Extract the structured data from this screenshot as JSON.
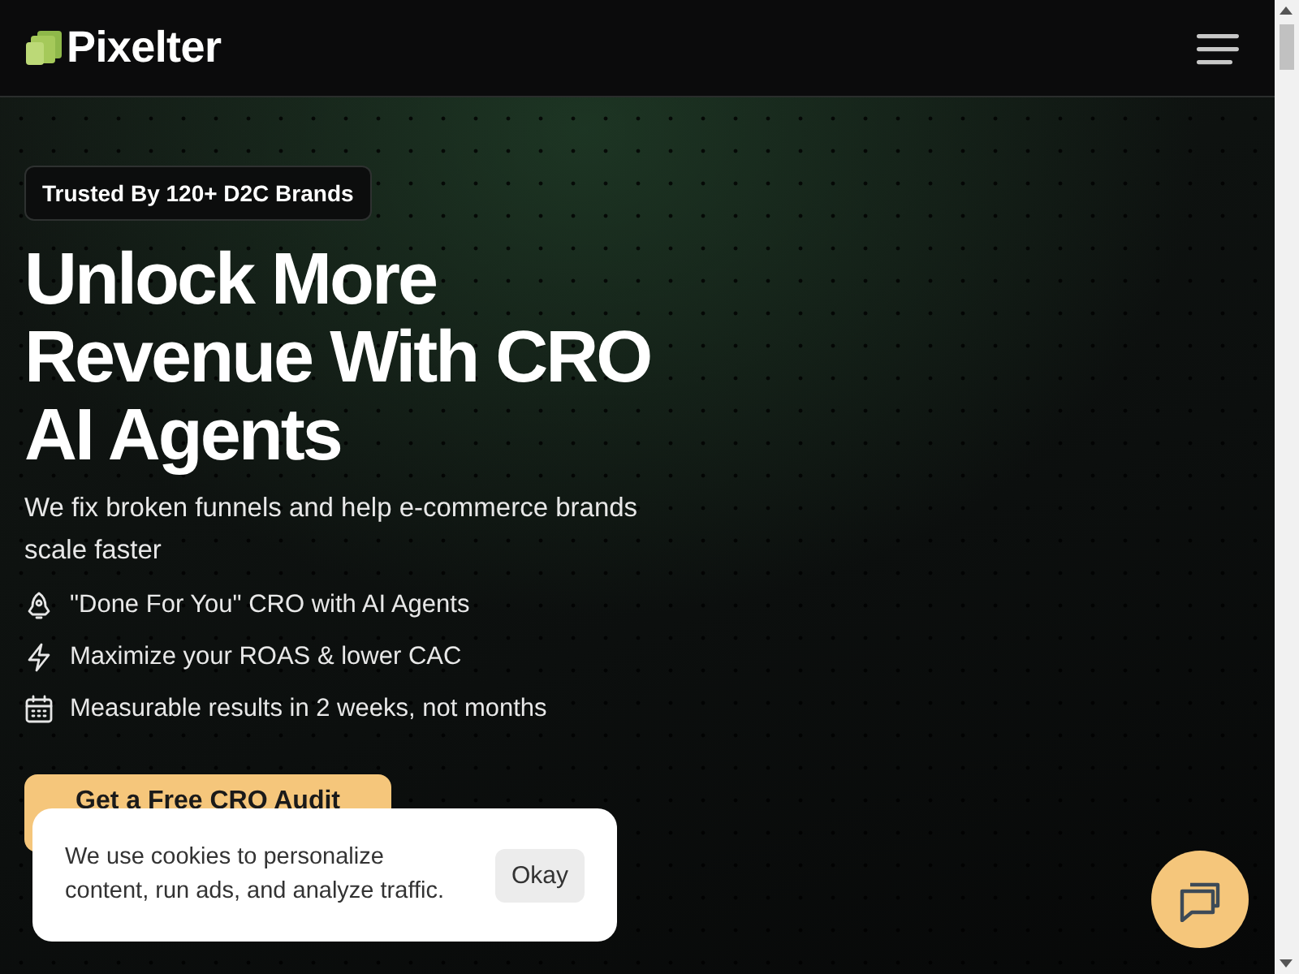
{
  "header": {
    "logo": "Pixelter"
  },
  "hero": {
    "badge": "Trusted By 120+ D2C Brands",
    "heading": "Unlock More Revenue With CRO AI Agents",
    "subheading": "We fix broken funnels and help e-commerce brands scale faster",
    "features": [
      {
        "kind": "rocket",
        "text": "\"Done For You\" CRO with AI Agents"
      },
      {
        "kind": "bolt",
        "text": "Maximize your ROAS & lower CAC"
      },
      {
        "kind": "calendar",
        "text": "Measurable results in 2 weeks, not months"
      }
    ],
    "cta": "Get a Free CRO Audit"
  },
  "cookie_banner": {
    "text": "We use cookies to personalize content, run ads, and analyze traffic.",
    "button": "Okay"
  }
}
